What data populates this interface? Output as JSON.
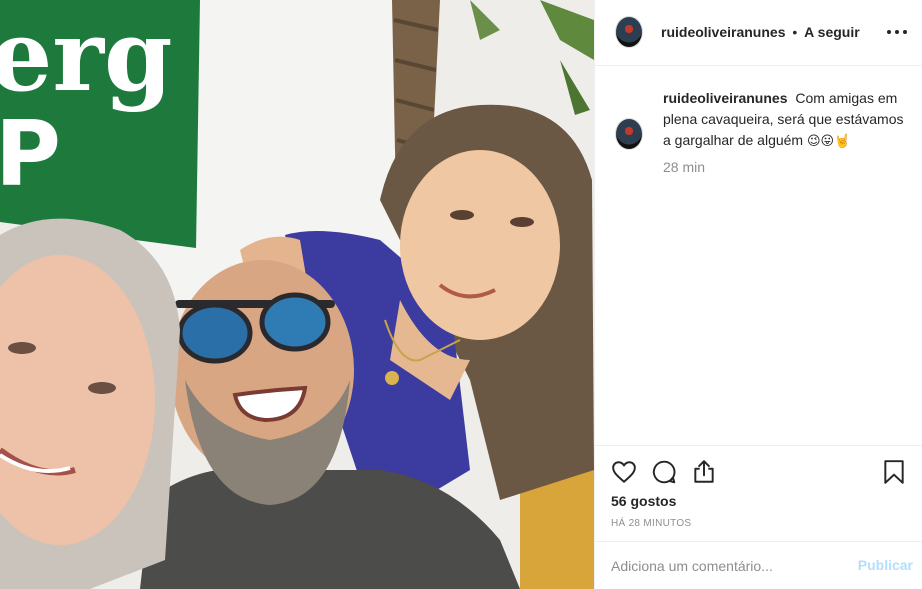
{
  "post": {
    "image_alt": "Selfie of three friends laughing",
    "sign_text": "erg",
    "sign_letter": "P"
  },
  "header": {
    "username": "ruideoliveiranunes",
    "separator": "•",
    "follow_label": "A seguir",
    "more_icon": "more-horizontal-icon"
  },
  "caption": {
    "username": "ruideoliveiranunes",
    "text": "Com amigas em plena cavaqueira, será que estávamos a gargalhar de alguém",
    "emojis": "😉😛🤘",
    "time": "28 min"
  },
  "actions": {
    "like_icon": "heart-icon",
    "comment_icon": "comment-icon",
    "share_icon": "share-icon",
    "save_icon": "bookmark-icon"
  },
  "likes": "56 gostos",
  "timestamp": "HÁ 28 MINUTOS",
  "comment_box": {
    "placeholder": "Adiciona um comentário...",
    "publish_label": "Publicar"
  },
  "colors": {
    "text": "#262626",
    "muted": "#8e8e8e",
    "border": "#efefef",
    "publish_disabled": "#b2dffc",
    "sign_green": "#1e7a3c"
  }
}
